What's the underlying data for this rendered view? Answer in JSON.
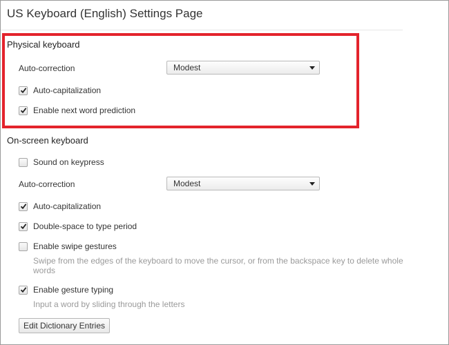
{
  "page": {
    "title": "US Keyboard (English) Settings Page"
  },
  "physical_keyboard": {
    "heading": "Physical keyboard",
    "autocorrection_label": "Auto-correction",
    "autocorrection_value": "Modest",
    "auto_capitalization": {
      "label": "Auto-capitalization",
      "checked": true
    },
    "next_word_prediction": {
      "label": "Enable next word prediction",
      "checked": true
    }
  },
  "onscreen_keyboard": {
    "heading": "On-screen keyboard",
    "sound_on_keypress": {
      "label": "Sound on keypress",
      "checked": false
    },
    "autocorrection_label": "Auto-correction",
    "autocorrection_value": "Modest",
    "auto_capitalization": {
      "label": "Auto-capitalization",
      "checked": true
    },
    "double_space_period": {
      "label": "Double-space to type period",
      "checked": true
    },
    "swipe_gestures": {
      "label": "Enable swipe gestures",
      "checked": false,
      "description": "Swipe from the edges of the keyboard to move the cursor, or from the backspace key to delete whole words"
    },
    "gesture_typing": {
      "label": "Enable gesture typing",
      "checked": true,
      "description": "Input a word by sliding through the letters"
    },
    "edit_dictionary_button": "Edit Dictionary Entries"
  },
  "colors": {
    "highlight": "#e3232c",
    "description_text": "#9a9a9a"
  }
}
